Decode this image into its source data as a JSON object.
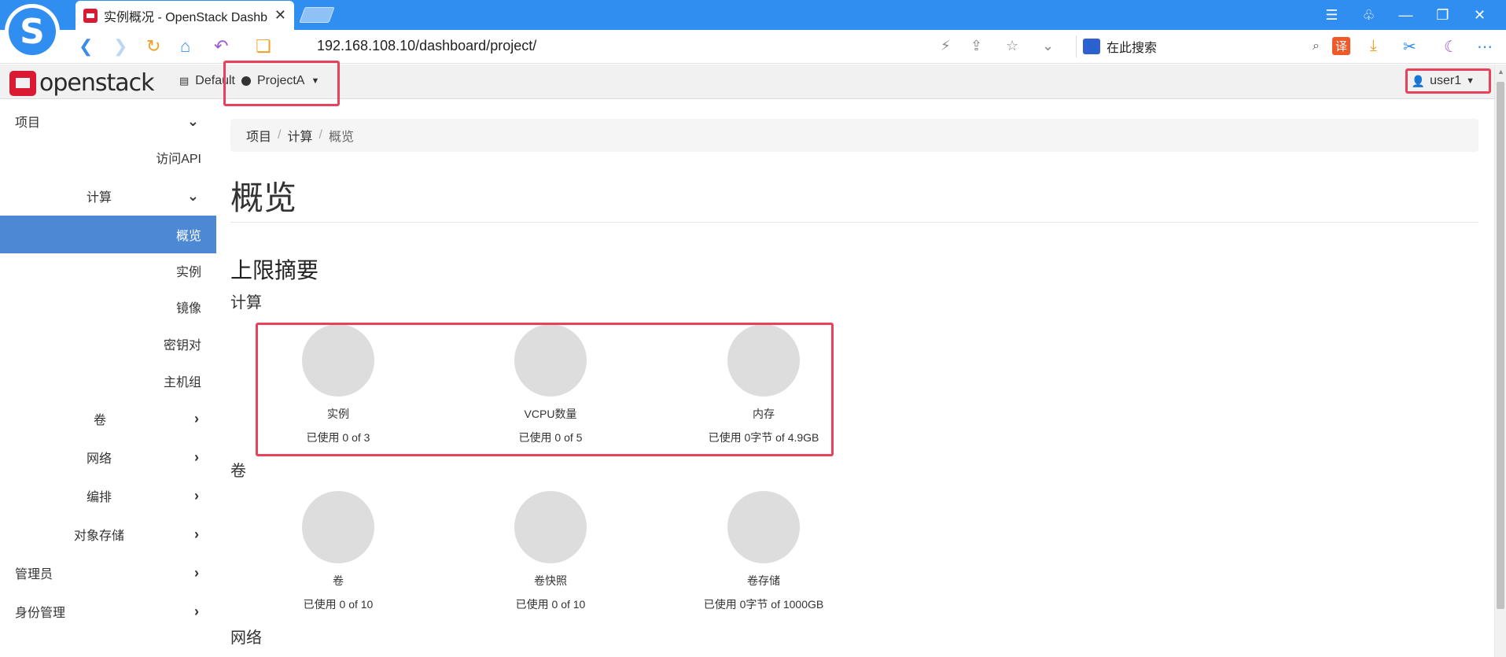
{
  "browser": {
    "tab_title": "实例概况 - OpenStack Dashb",
    "tab_close": "✕",
    "url": "192.168.108.10/dashboard/project/",
    "search_placeholder": "在此搜索",
    "logo_letter": "S",
    "translate_label": "译",
    "paw_glyph": "🐾"
  },
  "navbar": {
    "logo_text": "openstack",
    "domain_label": "Default",
    "project_label": "ProjectA",
    "user_label": "user1"
  },
  "sidebar": {
    "items": [
      {
        "label": "项目"
      },
      {
        "label": "访问API"
      },
      {
        "label": "计算"
      },
      {
        "label": "概览"
      },
      {
        "label": "实例"
      },
      {
        "label": "镜像"
      },
      {
        "label": "密钥对"
      },
      {
        "label": "主机组"
      },
      {
        "label": "卷"
      },
      {
        "label": "网络"
      },
      {
        "label": "编排"
      },
      {
        "label": "对象存储"
      },
      {
        "label": "管理员"
      },
      {
        "label": "身份管理"
      }
    ]
  },
  "main": {
    "breadcrumb": [
      "项目",
      "计算",
      "概览"
    ],
    "breadcrumb_sep": "/",
    "page_title": "概览",
    "limits_title": "上限摘要",
    "compute": {
      "label": "计算",
      "pies": [
        {
          "label": "实例",
          "usage": "已使用 0 of 3"
        },
        {
          "label": "VCPU数量",
          "usage": "已使用 0 of 5"
        },
        {
          "label": "内存",
          "usage": "已使用 0字节 of 4.9GB"
        }
      ]
    },
    "volume": {
      "label": "卷",
      "pies": [
        {
          "label": "卷",
          "usage": "已使用 0 of 10"
        },
        {
          "label": "卷快照",
          "usage": "已使用 0 of 10"
        },
        {
          "label": "卷存储",
          "usage": "已使用 0字节 of 1000GB"
        }
      ]
    },
    "network_label": "网络"
  }
}
